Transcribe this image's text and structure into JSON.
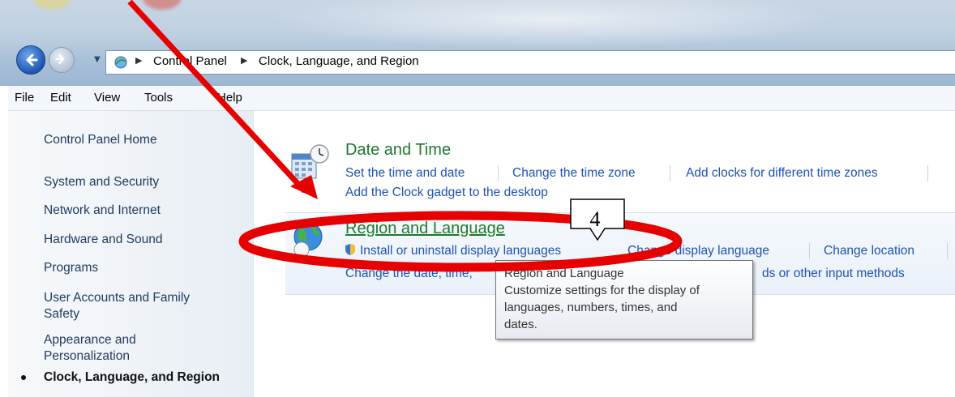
{
  "address_bar": {
    "crumbs": [
      "Control Panel",
      "Clock, Language, and Region"
    ]
  },
  "menu": [
    "File",
    "Edit",
    "View",
    "Tools",
    "Help"
  ],
  "sidebar": {
    "items": [
      {
        "label": "Control Panel Home"
      },
      {
        "label": "System and Security"
      },
      {
        "label": "Network and Internet"
      },
      {
        "label": "Hardware and Sound"
      },
      {
        "label": "Programs"
      },
      {
        "label_line1": "User Accounts and Family",
        "label_line2": "Safety"
      },
      {
        "label_line1": "Appearance and",
        "label_line2": "Personalization"
      },
      {
        "label": "Clock, Language, and Region",
        "active": true
      }
    ]
  },
  "categories": {
    "date_time": {
      "title": "Date and Time",
      "links": [
        "Set the time and date",
        "Change the time zone",
        "Add clocks for different time zones",
        "Add the Clock gadget to the desktop"
      ]
    },
    "region_language": {
      "title": "Region and Language",
      "links": [
        "Install or uninstall display languages",
        "Change display language",
        "Change location",
        "Change the date, time, or number format",
        "Change keyboards or other input methods"
      ],
      "link_visible": {
        "install": "Install or uninstall display languages",
        "display": "Change display language",
        "location": "Change location",
        "format": "Change the date, time,",
        "keyboards": "ds or other input methods"
      }
    }
  },
  "tooltip": {
    "title": "Region and Language",
    "lines": [
      "Customize settings for the display of",
      "languages, numbers, times, and",
      "dates."
    ]
  },
  "annotation": {
    "step_number": "4",
    "color": "#e60000"
  },
  "colors": {
    "link": "#1d52b6",
    "category_title": "#1e7a2e",
    "sidebar_text": "#1e3a5a"
  }
}
